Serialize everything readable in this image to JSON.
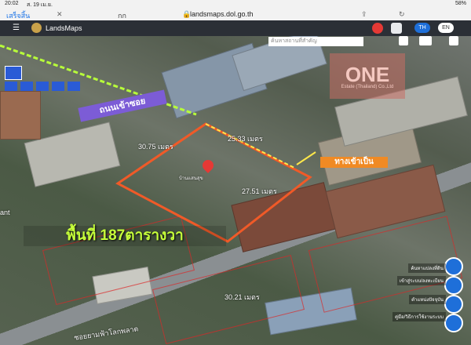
{
  "status": {
    "time": "20:02",
    "date": "ส. 19 เม.ย.",
    "battery": "58%"
  },
  "browser": {
    "done_label": "เสร็จสิ้น",
    "size_label": "กก",
    "url": "landsmaps.dol.go.th"
  },
  "app": {
    "name": "LandsMaps",
    "lang_th": "TH",
    "lang_en": "EN",
    "search_placeholder": "ค้นหาสถานที่สำคัญ"
  },
  "map": {
    "road_label": "ถนนเข้าซอย",
    "access_label": "ทางเข้าเป็น",
    "area_label": "พื้นที่ 187ตารางวา",
    "dims": {
      "top": "30.75 เมตร",
      "top_right": "25.33 เมตร",
      "right": "27.51 เมตร",
      "bottom": "30.21 เมตร"
    },
    "left_edge_text": "ant",
    "street_text": "ซอยยามฟ้าโลกพลาด",
    "pin_caption": "บ้านแสนสุข"
  },
  "watermark": {
    "big": "ONE",
    "small": "Estate (Thailand) Co.,Ltd"
  },
  "side_menu": [
    {
      "label": "ค้นหาแปลงที่ดิน"
    },
    {
      "label": "เข้าสู่ระบบ/ลงทะเบียน"
    },
    {
      "label": "ตำแหน่งปัจจุบัน"
    },
    {
      "label": "คู่มือ/วิธีการใช้งานระบบ"
    }
  ],
  "colors": {
    "parcel": "#f05a28",
    "area_text": "#c6ff3a",
    "road_label": "#a78bfa",
    "access": "#f08a24",
    "side_btn": "#1e6fd9"
  }
}
